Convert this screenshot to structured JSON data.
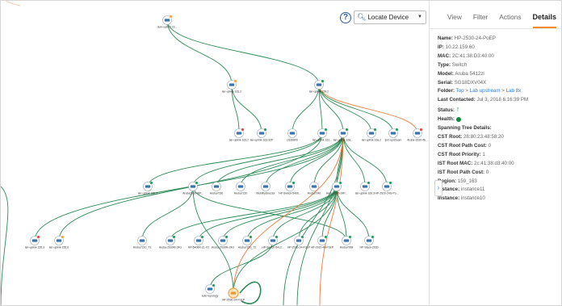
{
  "toolbar": {
    "help_label": "?",
    "locate_label": "Locate Device"
  },
  "tabs": [
    {
      "label": "View",
      "active": false
    },
    {
      "label": "Filter",
      "active": false
    },
    {
      "label": "Actions",
      "active": false
    },
    {
      "label": "Details",
      "active": true
    }
  ],
  "details": {
    "name_label": "Name:",
    "name_value": "HP-2530-24-PoEP",
    "ip_label": "IP:",
    "ip_value": "10.22.159.60",
    "mac_label": "MAC:",
    "mac_value": "2C:41:38:D3:40:00",
    "type_label": "Type:",
    "type_value": "Switch",
    "model_label": "Model:",
    "model_value": "Aruba 5412zl",
    "serial_label": "Serial:",
    "serial_value": "SG18DXV04X",
    "folder_label": "Folder:",
    "folder_parts": [
      "Top",
      "Lab upstream",
      "Lab 8x"
    ],
    "folder_sep": ">",
    "last_label": "Last Contacted:",
    "last_value": "Jul 3, 2018 6:16:39 PM",
    "status_label": "Status:",
    "status_icon": "arrow-up-icon",
    "status_color": "#12a34a",
    "health_label": "Health:",
    "health_color": "#0f8a3e",
    "stp_label": "Spanning Tree Details:",
    "cst_root_label": "CST Root:",
    "cst_root_value": "28:80:23:48:58:20",
    "cst_path_label": "CST Root Path Cost:",
    "cst_path_value": "0",
    "cst_prio_label": "CST Root Priority:",
    "cst_prio_value": "1",
    "ist_mac_label": "IST Root MAC:",
    "ist_mac_value": "2c:41:38:d3:40:00",
    "ist_path_label": "IST Root Path Cost:",
    "ist_path_value": "0",
    "region_label": "Region:",
    "region_value": "159_163",
    "instance1_label": "Instance:",
    "instance1_value": "instance11",
    "instance2_label": "Instance:",
    "instance2_value": "instance10"
  },
  "topology": {
    "colors": {
      "link": "#2e8b57",
      "link_alt": "#f07a3c",
      "node": "#3a74b0",
      "badge_orange": "#f2a23a",
      "badge_red": "#e2443a",
      "badge_green": "#1e9a57",
      "selected": "#f2a23a"
    },
    "nodes": [
      {
        "id": "n0",
        "label": "duni-uab12-22...",
        "badge": "orange",
        "selected": false
      },
      {
        "id": "n1",
        "label": "lan-uplink-163.2",
        "badge": "orange",
        "selected": false
      },
      {
        "id": "n2",
        "label": "lan-uplink-159.2",
        "badge": "green",
        "selected": false
      },
      {
        "id": "n3",
        "label": "lan-uplink-163.2",
        "badge": "red",
        "selected": false
      },
      {
        "id": "n4",
        "label": "lan-uplink-163-32P",
        "badge": "green",
        "selected": false
      },
      {
        "id": "n5",
        "label": "cl160800",
        "badge": "none",
        "selected": false
      },
      {
        "id": "n6",
        "label": "lan-uplink-161...",
        "badge": "green",
        "selected": false
      },
      {
        "id": "n7",
        "label": "lan-uplink-16a...",
        "badge": "green",
        "selected": false
      },
      {
        "id": "n8",
        "label": "lan-uplink-16a.2",
        "badge": "green",
        "selected": false
      },
      {
        "id": "n9",
        "label": "lpm-upstream",
        "badge": "green",
        "selected": false
      },
      {
        "id": "n10",
        "label": "Aruba-2930-46...",
        "badge": "red",
        "selected": false
      },
      {
        "id": "n11",
        "label": "lan-uplink-155.3",
        "badge": "green",
        "selected": false
      },
      {
        "id": "n12",
        "label": "Aruba2930-WP...",
        "badge": "green",
        "selected": false
      },
      {
        "id": "n13",
        "label": "Aruba7030",
        "badge": "none",
        "selected": false
      },
      {
        "id": "n14",
        "label": "Aruba7220",
        "badge": "none",
        "selected": false
      },
      {
        "id": "n15",
        "label": "MobilityDirector",
        "badge": "none",
        "selected": false
      },
      {
        "id": "n16",
        "label": "HP-Switch-5406...",
        "badge": "green",
        "selected": false
      },
      {
        "id": "n17",
        "label": "Aruba7240",
        "badge": "none",
        "selected": false
      },
      {
        "id": "n18",
        "label": "Aruba2930-24P...",
        "badge": "green",
        "selected": false
      },
      {
        "id": "n19",
        "label": "lan-uplink-160.3",
        "badge": "green",
        "selected": false
      },
      {
        "id": "n20",
        "label": "HP-2920-24G-Po...",
        "badge": "green",
        "selected": false
      },
      {
        "id": "n21",
        "label": "lan-uplink-155.3",
        "badge": "red",
        "selected": false
      },
      {
        "id": "n22",
        "label": "lan-uplink-155.6",
        "badge": "orange",
        "selected": false
      },
      {
        "id": "n23",
        "label": "Aruba7210_T1",
        "badge": "none",
        "selected": false
      },
      {
        "id": "n24",
        "label": "Aruba-2930M-24G",
        "badge": "green",
        "selected": false
      },
      {
        "id": "n25",
        "label": "HP-5406R-ZL-V2",
        "badge": "green",
        "selected": false
      },
      {
        "id": "n26",
        "label": "Aruba-2930M-24G",
        "badge": "green",
        "selected": false
      },
      {
        "id": "n27",
        "label": "Aruba7210_T2",
        "badge": "green",
        "selected": false
      },
      {
        "id": "n28",
        "label": "HP-Switch-5412...",
        "badge": "green",
        "selected": false
      },
      {
        "id": "n29",
        "label": "HP-2920-24-PoEP",
        "badge": "green",
        "selected": false
      },
      {
        "id": "n30",
        "label": "HP-2920-48-PoEP",
        "badge": "green",
        "selected": false
      },
      {
        "id": "n31",
        "label": "Aruba7008",
        "badge": "green",
        "selected": false
      },
      {
        "id": "n32",
        "label": "HP-Stack-2930",
        "badge": "green",
        "selected": false
      },
      {
        "id": "n33",
        "label": "auto-topology",
        "badge": "green",
        "selected": false
      },
      {
        "id": "n34",
        "label": "HP-2530-24-PoEP",
        "badge": "none",
        "selected": true
      }
    ]
  }
}
